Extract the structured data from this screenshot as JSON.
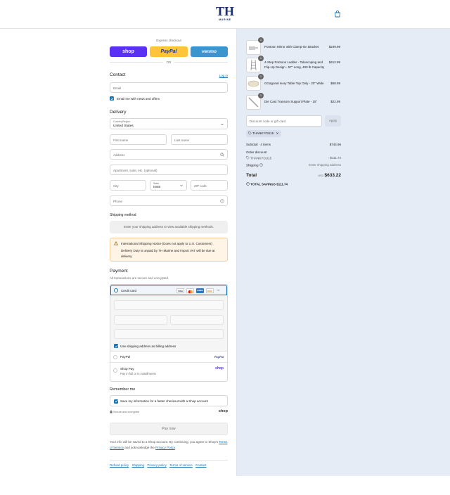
{
  "header": {
    "logo_mark": "TH",
    "logo_text": "MARINE",
    "cart_icon": "shopping-bag-icon"
  },
  "express": {
    "title": "Express checkout",
    "shop_label": "shop",
    "paypal_label": "PayPal",
    "venmo_label": "venmo",
    "or_label": "OR",
    "colors": {
      "shop": "#5a31f4",
      "paypal": "#ffc439",
      "venmo": "#3d95ce"
    }
  },
  "contact": {
    "title": "Contact",
    "login_link": "Log in",
    "email_placeholder": "Email",
    "newsletter_label": "Email me with news and offers",
    "newsletter_checked": true
  },
  "delivery": {
    "title": "Delivery",
    "country_label": "Country/Region",
    "country_value": "United States",
    "first_name_placeholder": "First name",
    "last_name_placeholder": "Last name",
    "address_placeholder": "Address",
    "apartment_placeholder": "Apartment, suite, etc. (optional)",
    "city_placeholder": "City",
    "state_label": "State",
    "state_value": "Iowa",
    "zip_placeholder": "ZIP code",
    "phone_placeholder": "Phone"
  },
  "shipping": {
    "title": "Shipping method",
    "message": "Enter your shipping address to view available shipping methods.",
    "notice_title": "International Shipping Notice (Does not apply to U.S. Customers)",
    "notice_body": "Delivery Duty is unpaid by TH Marine and import VAT will be due at delivery."
  },
  "payment": {
    "title": "Payment",
    "subtitle": "All transactions are secure and encrypted.",
    "credit_card_label": "Credit card",
    "card_brands": [
      "VISA",
      "MC",
      "AMEX",
      "DISC"
    ],
    "more_cards": "+4",
    "billing_label": "Use shipping address as billing address",
    "billing_checked": true,
    "paypal_label": "PayPal",
    "paypal_logo": "PayPal",
    "shoppay_label": "Shop Pay",
    "shoppay_sub": "Pay in full or in installments",
    "shoppay_logo": "shop"
  },
  "remember": {
    "title": "Remember me",
    "save_label": "Save my information for a faster checkout with a Shop account",
    "checked": true,
    "secure_label": "Secure and encrypted",
    "shop_logo": "shop"
  },
  "pay_button": "Pay now",
  "legal": {
    "text_before": "Your info will be saved to a Shop account. By continuing, you agree to Shop's",
    "terms": "Terms of Service",
    "text_middle": "and acknowledge the",
    "privacy": "Privacy Policy",
    "end": "."
  },
  "footer_links": [
    "Refund policy",
    "Shipping",
    "Privacy policy",
    "Terms of service",
    "Contact"
  ],
  "cart": {
    "items": [
      {
        "qty": "1",
        "name": "Pontoon Mirror with Clamp-On Bracket",
        "price": "$249.99"
      },
      {
        "qty": "1",
        "name": "4-Step Pontoon Ladder - Telescoping and Flip-Up Design - 57\" Long, 400 lb Capacity",
        "price": "$412.99"
      },
      {
        "qty": "1",
        "name": "Octagonal Ivory Table Top Only - 20\" Wide",
        "price": "$58.99"
      },
      {
        "qty": "1",
        "name": "Die Cast Transom Support Plate - 15\"",
        "price": "$22.99"
      }
    ],
    "discount_placeholder": "Discount code or gift card",
    "apply_label": "Apply",
    "applied_code": "THANKYOU15",
    "subtotal_label": "Subtotal · 4 items",
    "subtotal_value": "$744.96",
    "order_discount_label": "Order discount",
    "discount_code": "THANKYOU15",
    "discount_value": "- $111.74",
    "shipping_label": "Shipping",
    "shipping_value": "Enter shipping address",
    "total_label": "Total",
    "currency": "USD",
    "total_value": "$633.22",
    "savings_label": "TOTAL SAVINGS",
    "savings_value": "$111.74"
  }
}
